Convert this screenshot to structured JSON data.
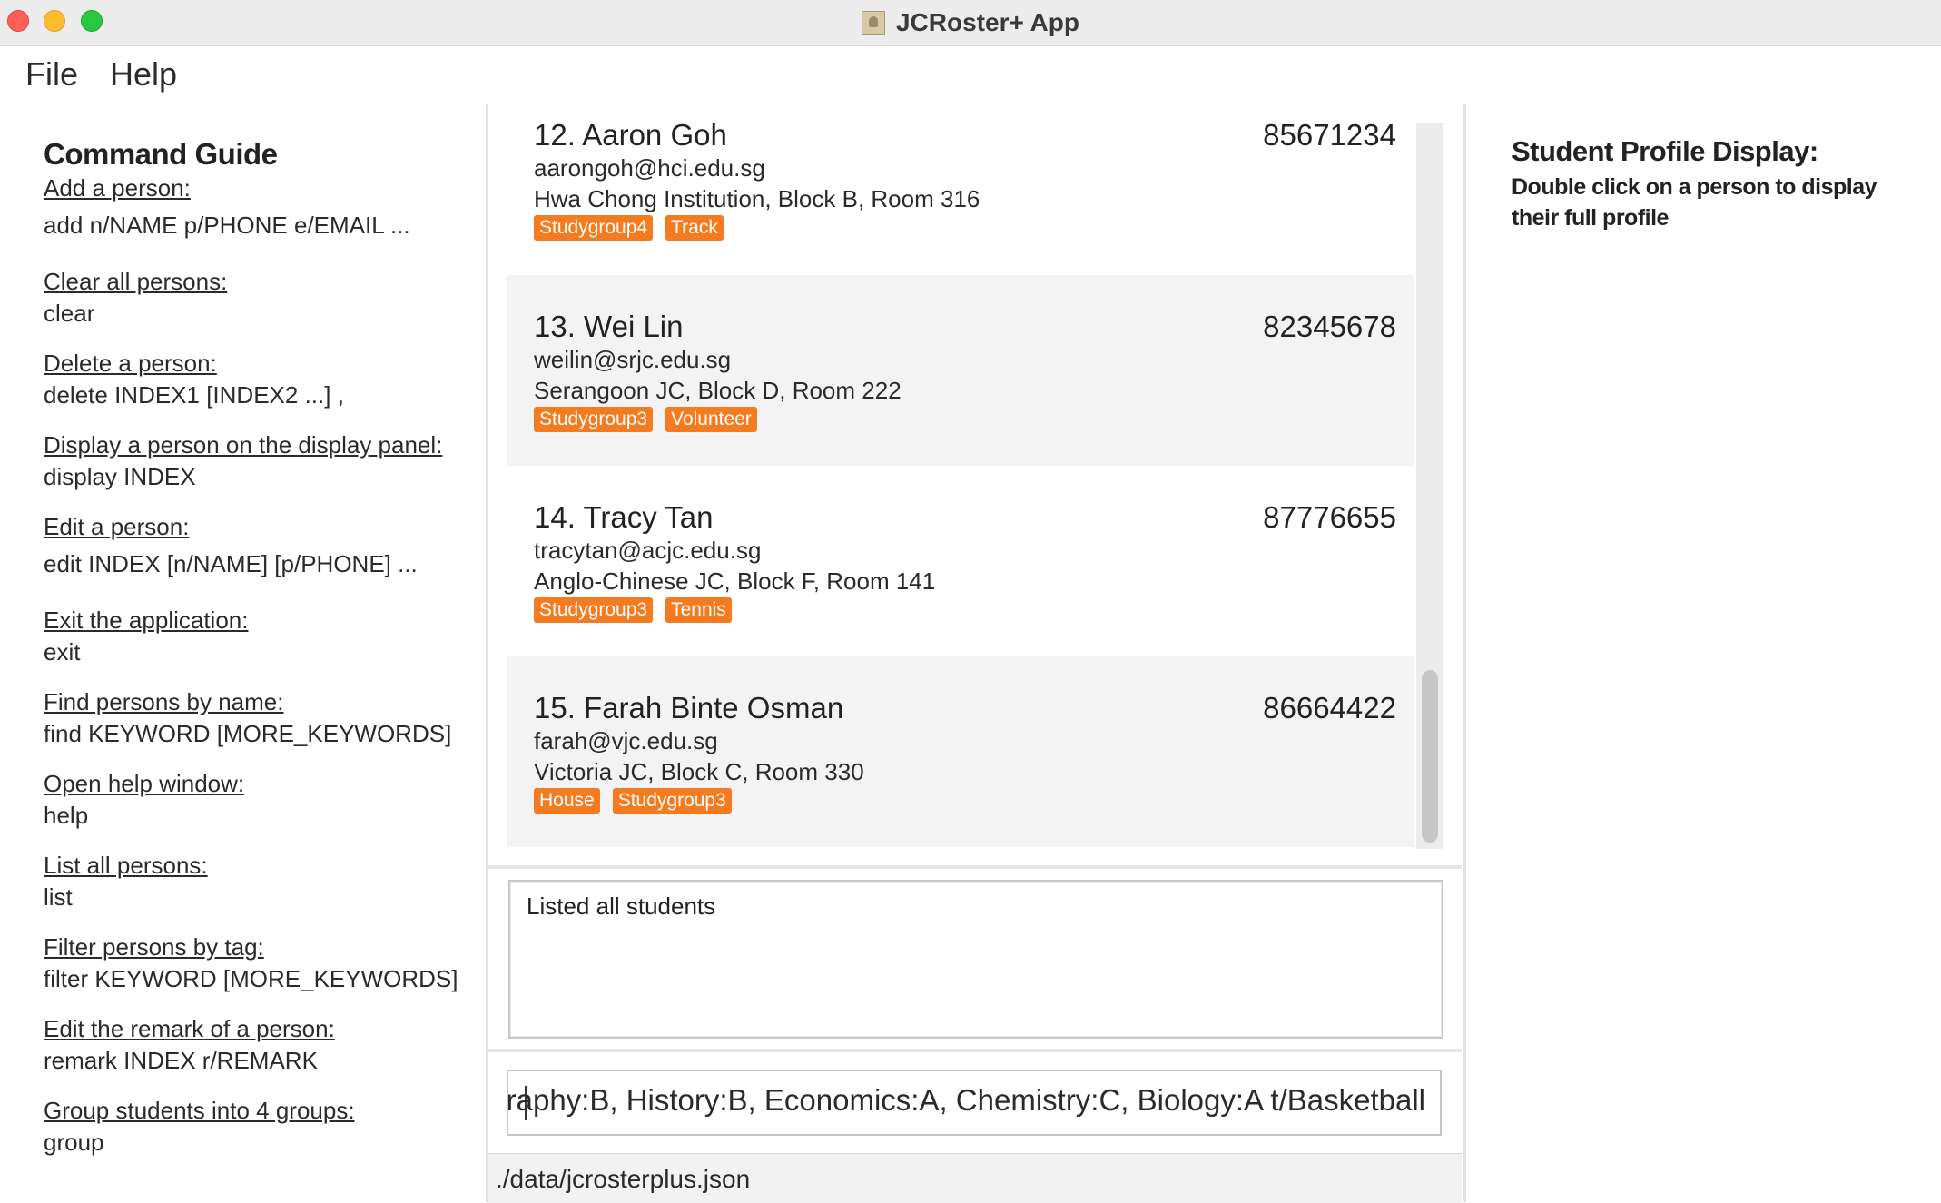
{
  "window": {
    "title": "JCRoster+ App"
  },
  "menu": {
    "file": "File",
    "help": "Help"
  },
  "guide": {
    "title": "Command Guide",
    "items": [
      {
        "label": "Add a person:",
        "cmd": "add n/NAME p/PHONE e/EMAIL ..."
      },
      {
        "label": "Clear all persons:",
        "cmd": "clear"
      },
      {
        "label": "Delete a person:",
        "cmd": "delete INDEX1 [INDEX2 ...] ,"
      },
      {
        "label": "Display a person on the display panel:",
        "cmd": "display INDEX"
      },
      {
        "label": "Edit a person:",
        "cmd": "edit INDEX [n/NAME] [p/PHONE] ..."
      },
      {
        "label": "Exit the application:",
        "cmd": "exit"
      },
      {
        "label": "Find persons by name:",
        "cmd": "find KEYWORD [MORE_KEYWORDS]"
      },
      {
        "label": "Open help window:",
        "cmd": "help"
      },
      {
        "label": "List all persons:",
        "cmd": "list"
      },
      {
        "label": "Filter persons by tag:",
        "cmd": "filter KEYWORD [MORE_KEYWORDS]"
      },
      {
        "label": "Edit the remark of a person:",
        "cmd": "remark INDEX r/REMARK"
      },
      {
        "label": "Group students into 4 groups:",
        "cmd": "group"
      }
    ]
  },
  "persons": [
    {
      "name": "12. Aaron Goh",
      "phone": "85671234",
      "email": "aarongoh@hci.edu.sg",
      "address": "Hwa Chong Institution, Block B, Room 316",
      "tags": [
        "Studygroup4",
        "Track"
      ]
    },
    {
      "name": "13. Wei Lin",
      "phone": "82345678",
      "email": "weilin@srjc.edu.sg",
      "address": "Serangoon JC, Block D, Room 222",
      "tags": [
        "Studygroup3",
        "Volunteer"
      ]
    },
    {
      "name": "14. Tracy Tan",
      "phone": "87776655",
      "email": "tracytan@acjc.edu.sg",
      "address": "Anglo-Chinese JC, Block F, Room 141",
      "tags": [
        "Studygroup3",
        "Tennis"
      ]
    },
    {
      "name": "15. Farah Binte Osman",
      "phone": "86664422",
      "email": "farah@vjc.edu.sg",
      "address": "Victoria JC, Block C, Room 330",
      "tags": [
        "House",
        "Studygroup3"
      ]
    }
  ],
  "result": {
    "text": "Listed all students"
  },
  "command": {
    "value": "raphy:B, History:B, Economics:A, Chemistry:C, Biology:A t/Basketball"
  },
  "status": {
    "path": "./data/jcrosterplus.json"
  },
  "profile": {
    "title": "Student Profile Display:",
    "subtitle": "Double click on a person to display their full profile"
  },
  "colors": {
    "tag": "#f47b20",
    "card_alt": "#f3f3f3"
  }
}
